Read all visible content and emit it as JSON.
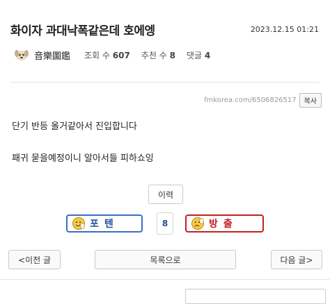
{
  "post": {
    "title": "화이자 과대낙폭같은데 호에엥",
    "date": "2023.12.15 01:21",
    "author": "音樂圖鑑",
    "views_label": "조회 수",
    "views": "607",
    "recommend_label": "추천 수",
    "recommend": "8",
    "comments_label": "댓글",
    "comments": "4",
    "url": "fmkorea.com/6506826517",
    "copy_label": "복사",
    "body": [
      "단기 반등 올거같아서 진입합니다",
      "패귀 묻을예정이니 알아서들 피하쇼잉"
    ]
  },
  "actions": {
    "history_label": "이력",
    "vote_up_label": "포텐",
    "vote_count": "8",
    "vote_down_label": "방출"
  },
  "nav": {
    "prev_label": "<이전 글",
    "list_label": "목록으로",
    "next_label": "다음 글>"
  },
  "colors": {
    "vote_up": "#1f4f9c",
    "vote_up_border": "#3a6fc4",
    "vote_down": "#c51f1f"
  },
  "icons": {
    "avatar": "puppy-avatar",
    "vote_up": "thumbs-up-face-icon",
    "vote_down": "thumbs-down-face-icon"
  }
}
